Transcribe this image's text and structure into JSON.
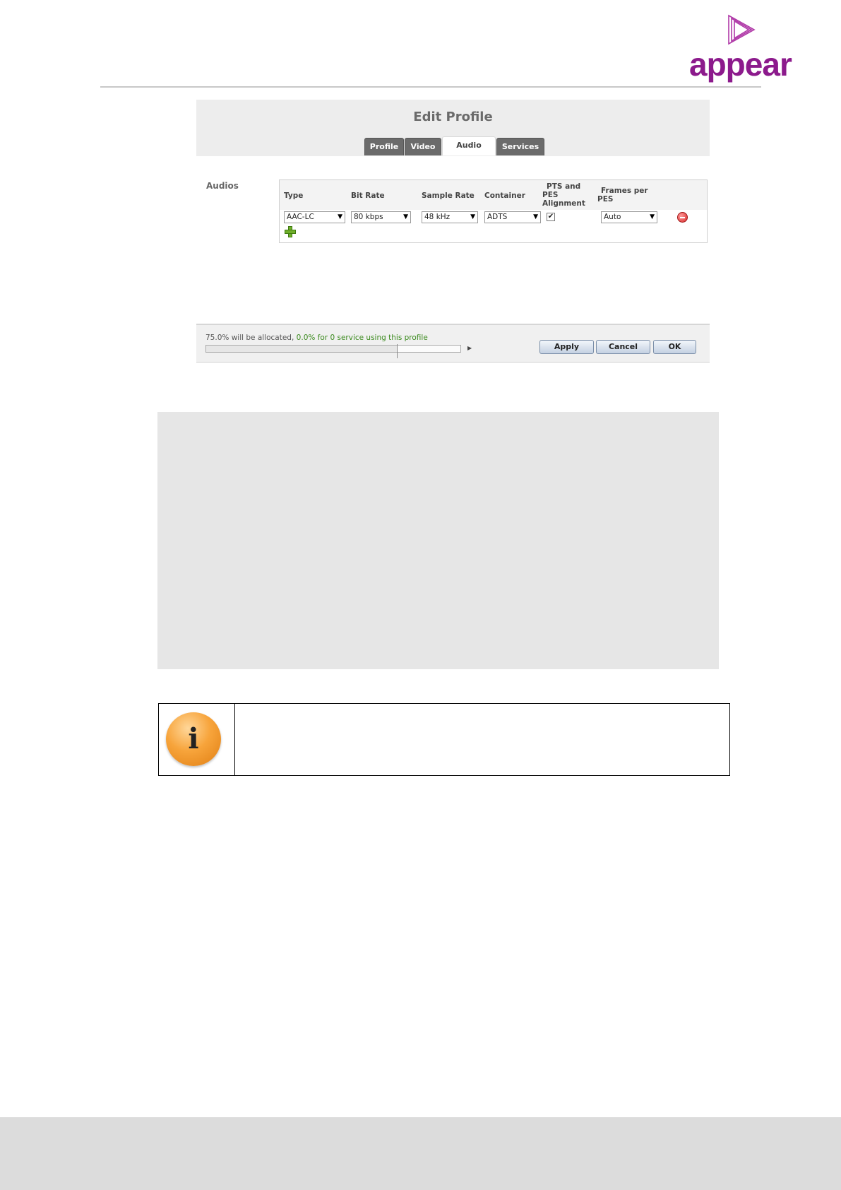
{
  "logo": {
    "text": "appear",
    "icon": "play-triangle-logo-icon",
    "color": "#8c1a8c"
  },
  "panel": {
    "title": "Edit Profile",
    "tabs": [
      "Profile",
      "Video",
      "Audio",
      "Services"
    ],
    "active_tab": "Audio"
  },
  "audios": {
    "label": "Audios",
    "columns": {
      "type": "Type",
      "bit_rate": "Bit Rate",
      "sample_rate": "Sample Rate",
      "container": "Container",
      "pts_l1": "PTS and",
      "pts_l2": "PES",
      "pts_l3": "Alignment",
      "fpp_l1": "Frames per",
      "fpp_l2": "PES"
    },
    "row": {
      "type": "AAC-LC",
      "bit_rate": "80 kbps",
      "sample_rate": "48 kHz",
      "container": "ADTS",
      "pts_alignment_checked": true,
      "frames_per_pes": "Auto"
    },
    "remove_icon": "minus-circle-icon",
    "add_icon": "plus-icon"
  },
  "status": {
    "allocated": "75.0% will be allocated,",
    "service_usage": "0.0% for 0 service using this profile",
    "allocation_fraction": 0.75
  },
  "buttons": {
    "apply": "Apply",
    "cancel": "Cancel",
    "ok": "OK"
  },
  "info_icon": "info-icon",
  "colors": {
    "accent_green": "#3b8a1e",
    "tab_dark": "#6b6b6b",
    "info_orange": "#f7a43b"
  }
}
